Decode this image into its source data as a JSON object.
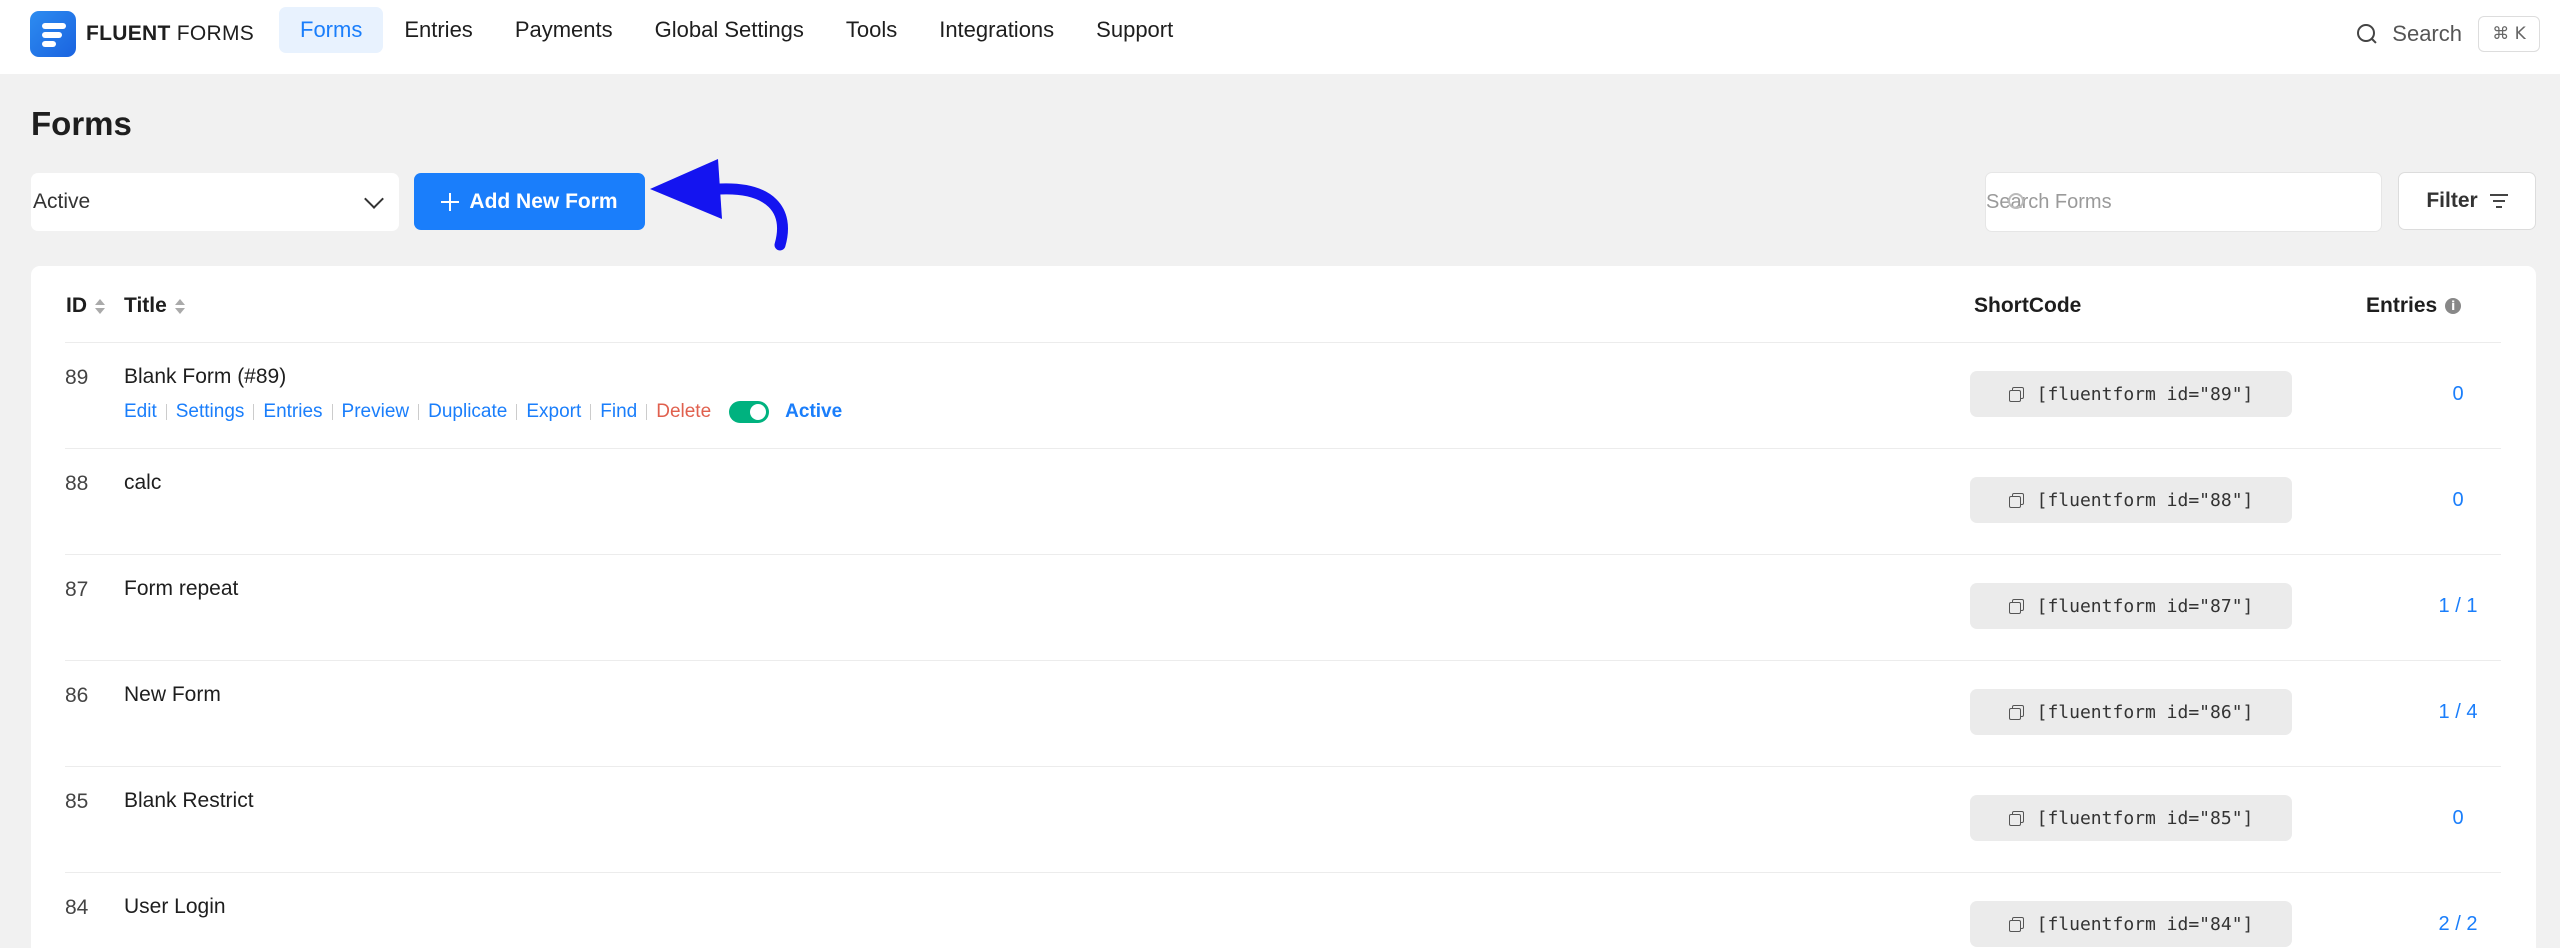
{
  "brand": {
    "name_bold": "FLUENT",
    "name_light": " FORMS"
  },
  "nav": {
    "items": [
      {
        "label": "Forms",
        "active": true
      },
      {
        "label": "Entries"
      },
      {
        "label": "Payments"
      },
      {
        "label": "Global Settings"
      },
      {
        "label": "Tools"
      },
      {
        "label": "Integrations"
      },
      {
        "label": "Support"
      }
    ]
  },
  "top_search": {
    "label": "Search",
    "shortcut": "⌘ K"
  },
  "page": {
    "title": "Forms"
  },
  "toolbar": {
    "status_value": "Active",
    "add_label": "Add New Form",
    "search_placeholder": "Search Forms",
    "filter_label": "Filter"
  },
  "table": {
    "columns": {
      "id": "ID",
      "title": "Title",
      "shortcode": "ShortCode",
      "entries": "Entries"
    },
    "row_actions": [
      "Edit",
      "Settings",
      "Entries",
      "Preview",
      "Duplicate",
      "Export",
      "Find",
      "Delete"
    ],
    "status_label": "Active",
    "rows": [
      {
        "id": "89",
        "title": "Blank Form (#89)",
        "shortcode": "[fluentform id=\"89\"]",
        "entries": "0"
      },
      {
        "id": "88",
        "title": "calc",
        "shortcode": "[fluentform id=\"88\"]",
        "entries": "0"
      },
      {
        "id": "87",
        "title": "Form repeat",
        "shortcode": "[fluentform id=\"87\"]",
        "entries": "1 / 1"
      },
      {
        "id": "86",
        "title": "New Form",
        "shortcode": "[fluentform id=\"86\"]",
        "entries": "1 / 4"
      },
      {
        "id": "85",
        "title": "Blank Restrict",
        "shortcode": "[fluentform id=\"85\"]",
        "entries": "0"
      },
      {
        "id": "84",
        "title": "User Login",
        "shortcode": "[fluentform id=\"84\"]",
        "entries": "2 / 2"
      }
    ]
  },
  "colors": {
    "accent": "#1a7efb",
    "danger": "#e0604e",
    "toggle_on": "#00b27f",
    "annotation": "#1414f0"
  }
}
